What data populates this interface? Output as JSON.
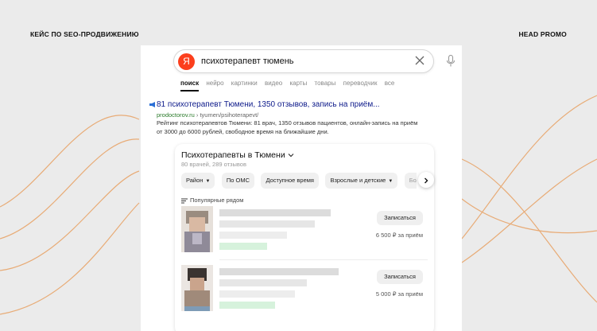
{
  "header": {
    "left_label": "КЕЙС ПО SEO-ПРОДВИЖЕНИЮ",
    "right_label": "HEAD PROMO"
  },
  "search": {
    "logo_letter": "Я",
    "query": "психотерапевт тюмень",
    "clear_icon": "close-icon",
    "mic_icon": "microphone-icon"
  },
  "tabs": [
    {
      "label": "поиск",
      "active": true
    },
    {
      "label": "нейро",
      "active": false
    },
    {
      "label": "картинки",
      "active": false
    },
    {
      "label": "видео",
      "active": false
    },
    {
      "label": "карты",
      "active": false
    },
    {
      "label": "товары",
      "active": false
    },
    {
      "label": "переводчик",
      "active": false
    },
    {
      "label": "все",
      "active": false
    }
  ],
  "result": {
    "promo_icon": "megaphone-icon",
    "title": "81 психотерапевт Тюмени, 1350 отзывов, запись на приём...",
    "url_domain": "prodoctorov.ru",
    "url_path": " › tyumen/psihoterapevt/",
    "snippet": "Рейтинг психотерапевтов Тюмени: 81 врач, 1350 отзывов пациентов, онлайн-запись на приём от 3000 до 6000 рублей, свободное время на ближайшие дни."
  },
  "card": {
    "title_main": "Психотерапевты",
    "title_city": " в Тюмени",
    "title_dropdown_icon": "chevron-down-icon",
    "subtitle": "80 врачей, 289 отзывов",
    "chips": [
      {
        "label": "Район",
        "dropdown": true
      },
      {
        "label": "По ОМС",
        "dropdown": false
      },
      {
        "label": "Доступное время",
        "dropdown": false
      },
      {
        "label": "Взрослые и детские",
        "dropdown": true
      },
      {
        "label": "Болезни",
        "dropdown": false
      }
    ],
    "next_icon": "chevron-right-icon",
    "popular_label": "Популярные рядом",
    "doctors": [
      {
        "book_label": "Записаться",
        "price": "6 500 ₽ за приём"
      },
      {
        "book_label": "Записаться",
        "price": "5 000 ₽ за приём"
      }
    ]
  },
  "colors": {
    "logo_red": "#fc3f1d",
    "link_blue": "#0d1a8a",
    "url_green": "#2a7a2a",
    "curve_orange": "#e8a56a"
  }
}
